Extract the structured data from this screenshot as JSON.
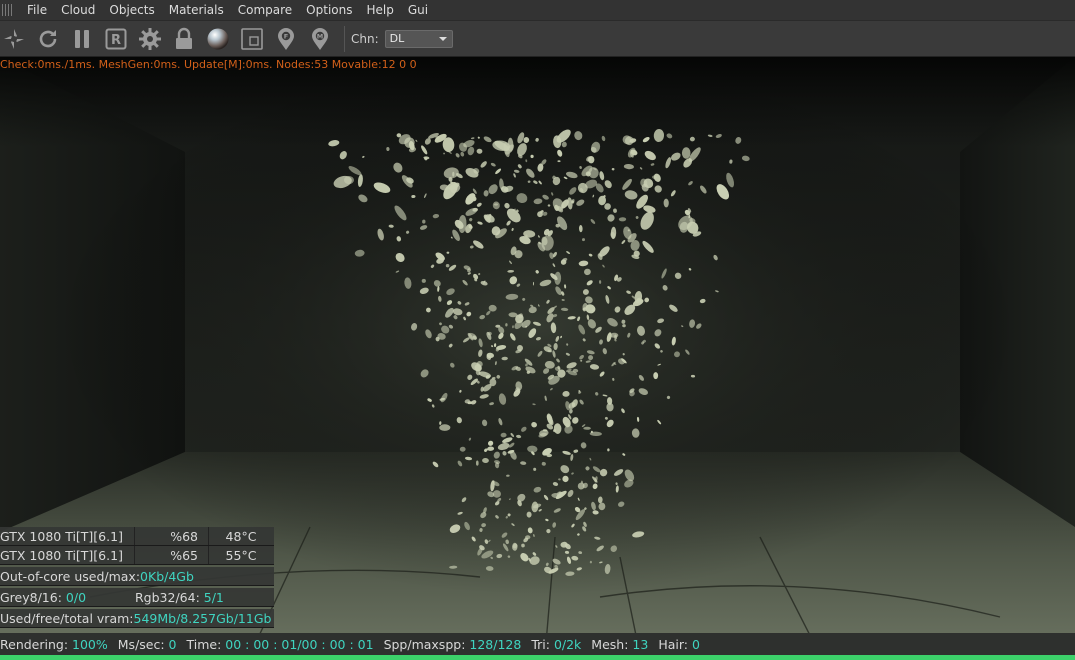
{
  "menu": [
    "File",
    "Cloud",
    "Objects",
    "Materials",
    "Compare",
    "Options",
    "Help",
    "Gui"
  ],
  "toolbar": {
    "icons": [
      "send-to-octane-icon",
      "restart-icon",
      "pause-icon",
      "r-icon",
      "settings-gear-icon",
      "lock-icon",
      "material-sphere-icon",
      "region-render-icon",
      "focus-pin-icon",
      "material-pin-icon"
    ],
    "channel_label": "Chn:",
    "channel_value": "DL"
  },
  "viewport": {
    "status_line": "Check:0ms./1ms. MeshGen:0ms. Update[M]:0ms. Nodes:53 Movable:12  0 0"
  },
  "stats": {
    "gpus": [
      {
        "name": "GTX 1080 Ti[T][6.1]",
        "util": "%68",
        "temp": "48°C"
      },
      {
        "name": "GTX 1080 Ti[T][6.1]",
        "util": "%65",
        "temp": "55°C"
      }
    ],
    "out_of_core_label": "Out-of-core used/max:",
    "out_of_core_value": "0Kb/4Gb",
    "grey_label": "Grey8/16: ",
    "grey_value": "0/0",
    "rgb_label": "Rgb32/64: ",
    "rgb_value": "5/1",
    "vram_label": "Used/free/total vram: ",
    "vram_value": "549Mb/8.257Gb/11Gb"
  },
  "statusbar": {
    "rendering_label": "Rendering: ",
    "rendering_value": "100%",
    "mssec_label": "Ms/sec: ",
    "mssec_value": "0",
    "time_label": "Time: ",
    "time_value": "00 : 00 : 01/00 : 00 : 01",
    "spp_label": "Spp/maxspp: ",
    "spp_value": "128/128",
    "tri_label": "Tri: ",
    "tri_value": "0/2k",
    "mesh_label": "Mesh: ",
    "mesh_value": "13",
    "hair_label": "Hair: ",
    "hair_value": "0",
    "progress": 1.0,
    "progress_color": "#3cd16a"
  },
  "colors": {
    "status_orange": "#d2601a",
    "value_cyan": "#3fd4c0"
  }
}
